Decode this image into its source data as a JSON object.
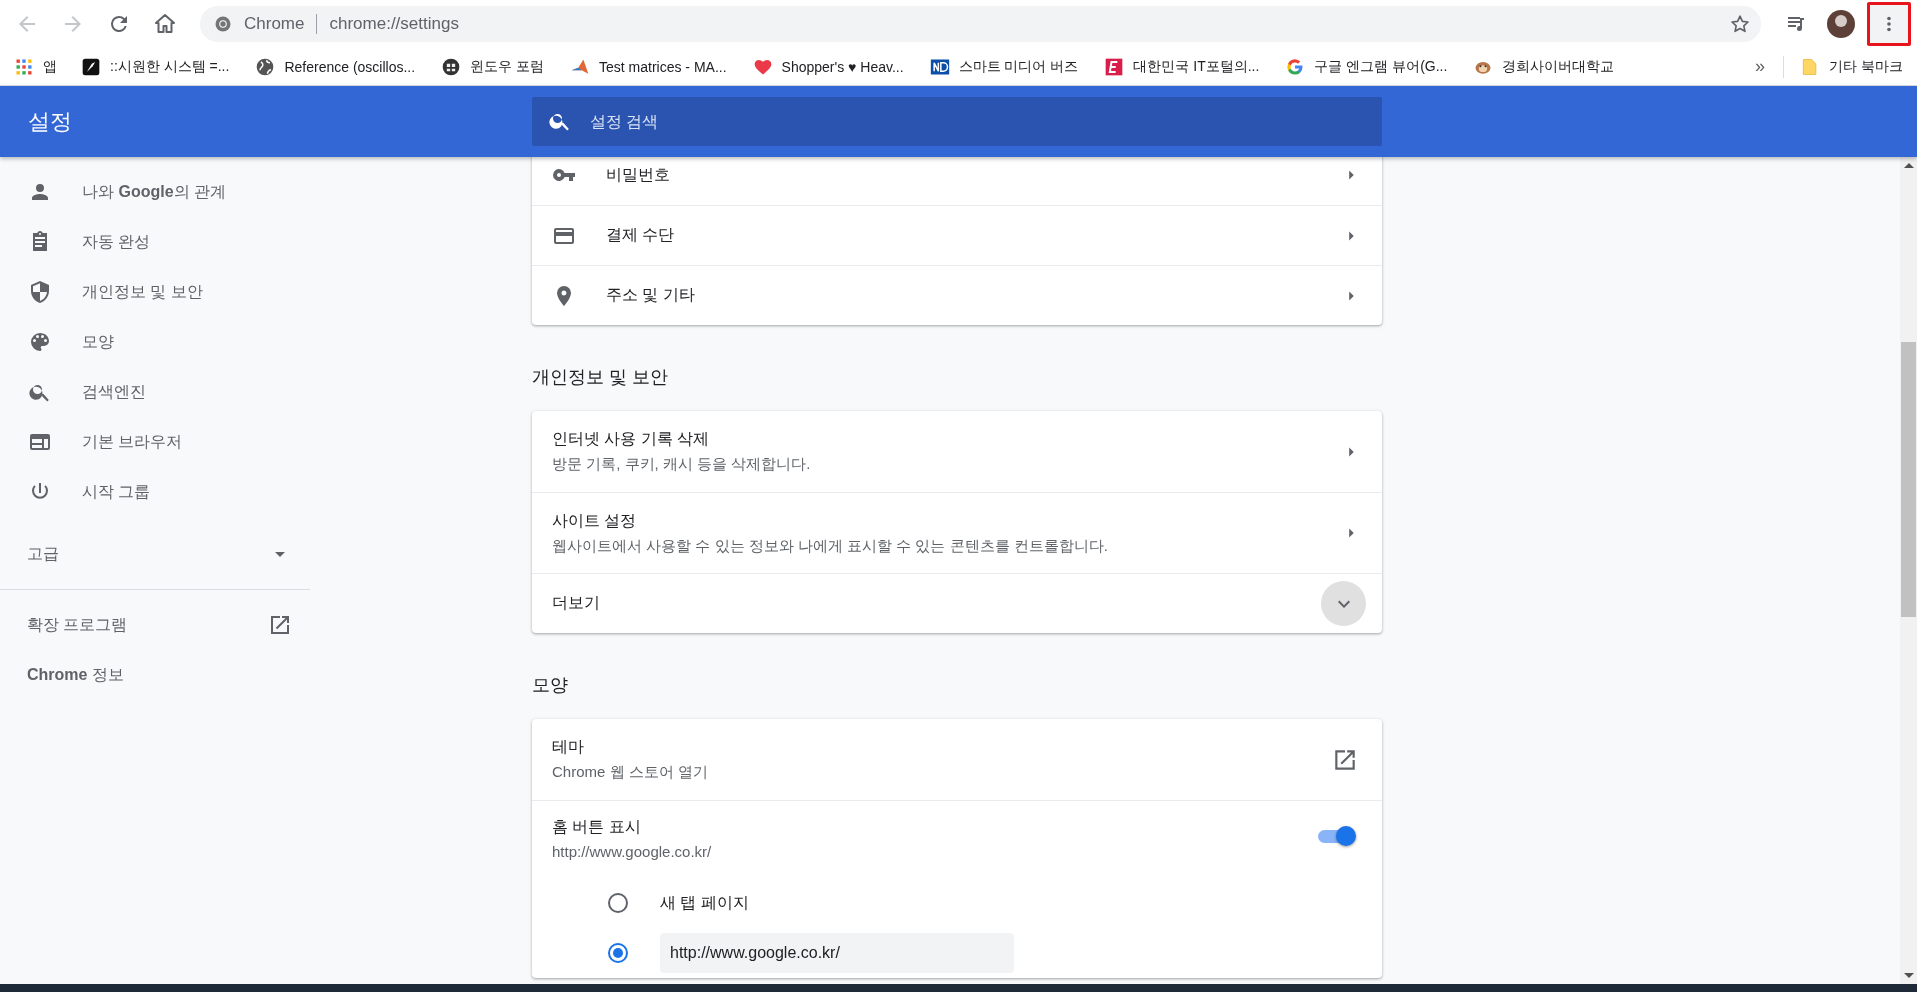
{
  "toolbar": {
    "nav_buttons": [
      {
        "disabled": true
      },
      {
        "disabled": true
      },
      {
        "disabled": false
      },
      {
        "disabled": false
      }
    ],
    "omnibox": {
      "site_label": "Chrome",
      "url": "chrome://settings"
    },
    "menu_button": {
      "highlighted": true
    }
  },
  "bookmarks": [
    {
      "label": "앱"
    },
    {
      "label": "::시원한 시스템 =..."
    },
    {
      "label": "Reference (oscillos..."
    },
    {
      "label": "윈도우 포럼"
    },
    {
      "label": "Test matrices - MA..."
    },
    {
      "label": "Shopper's ♥ Heav..."
    },
    {
      "label": "스마트 미디어 버즈"
    },
    {
      "label": "대한민국 IT포털의..."
    },
    {
      "label": "구글 엔그램 뷰어(G..."
    },
    {
      "label": "경희사이버대학교"
    }
  ],
  "bookmarks_overflow": "»",
  "other_bookmarks": "기타 북마크",
  "header": {
    "title": "설정",
    "search_placeholder": "설정 검색"
  },
  "sidebar": {
    "items": [
      {
        "label": "나와 **Google**의 관계"
      },
      {
        "label": "자동 완성"
      },
      {
        "label": "개인정보 및 보안"
      },
      {
        "label": "모양"
      },
      {
        "label": "검색엔진"
      },
      {
        "label": "기본 브라우저"
      },
      {
        "label": "시작 그룹"
      }
    ],
    "advanced": {
      "label": "고급",
      "expanded": false
    },
    "extensions": "확장 프로그램",
    "about": "**Chrome** 정보"
  },
  "sections": [
    {
      "rows": [
        {
          "kind": "link",
          "label": "비밀번호"
        },
        {
          "kind": "link",
          "label": "결제 수단"
        },
        {
          "kind": "link",
          "label": "주소 및 기타"
        }
      ]
    },
    {
      "title": "개인정보 및 보안",
      "rows": [
        {
          "kind": "link",
          "label": "인터넷 사용 기록 삭제",
          "sublabel": "방문 기록, 쿠키, 캐시 등을 삭제합니다."
        },
        {
          "kind": "link",
          "label": "사이트 설정",
          "sublabel": "웹사이트에서 사용할 수 있는 정보와 나에게 표시할 수 있는 콘텐츠를 컨트롤합니다."
        },
        {
          "kind": "more",
          "label": "더보기"
        }
      ]
    },
    {
      "title": "모양",
      "rows": [
        {
          "kind": "external",
          "label": "테마",
          "sublabel": "Chrome 웹 스토어 열기"
        },
        {
          "kind": "toggle",
          "label": "홈 버튼 표시",
          "sublabel": "http://www.google.co.kr/",
          "on": true
        },
        {
          "kind": "radio",
          "label": "새 탭 페이지",
          "selected": false
        },
        {
          "kind": "radio-input",
          "value": "http://www.google.co.kr/",
          "selected": true
        }
      ]
    }
  ]
}
